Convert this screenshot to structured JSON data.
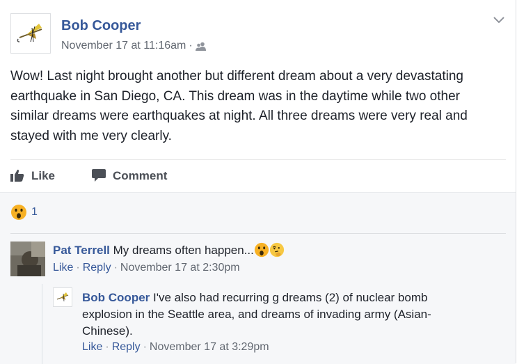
{
  "post": {
    "author": "Bob Cooper",
    "timestamp": "November 17 at 11:16am",
    "separator": "·",
    "audience_icon": "friends-icon",
    "text": "Wow! Last night brought another but different dream about a very devastating earthquake in San Diego, CA. This dream was in the daytime while two other similar dreams were earthquakes at night. All three dreams were very real and stayed with me very clearly."
  },
  "actions": {
    "like_label": "Like",
    "comment_label": "Comment"
  },
  "reactions": {
    "icon": "wow-emoji-icon",
    "count": "1"
  },
  "comments": [
    {
      "author": "Pat Terrell",
      "text": "My dreams often happen...",
      "emojis": [
        "wow-emoji-icon",
        "thinking-emoji-icon"
      ],
      "like_label": "Like",
      "reply_label": "Reply",
      "separator": "·",
      "timestamp": "November 17 at 2:30pm",
      "reply": {
        "author": "Bob Cooper",
        "text": "I've also had recurring g dreams (2) of nuclear bomb explosion in the Seattle area, and dreams of invading army (Asian-Chinese).",
        "like_label": "Like",
        "reply_label": "Reply",
        "separator": "·",
        "timestamp": "November 17 at 3:29pm"
      }
    }
  ],
  "colors": {
    "link": "#365899",
    "meta": "#616770",
    "text": "#1d2129",
    "wow": "#f7b125"
  }
}
